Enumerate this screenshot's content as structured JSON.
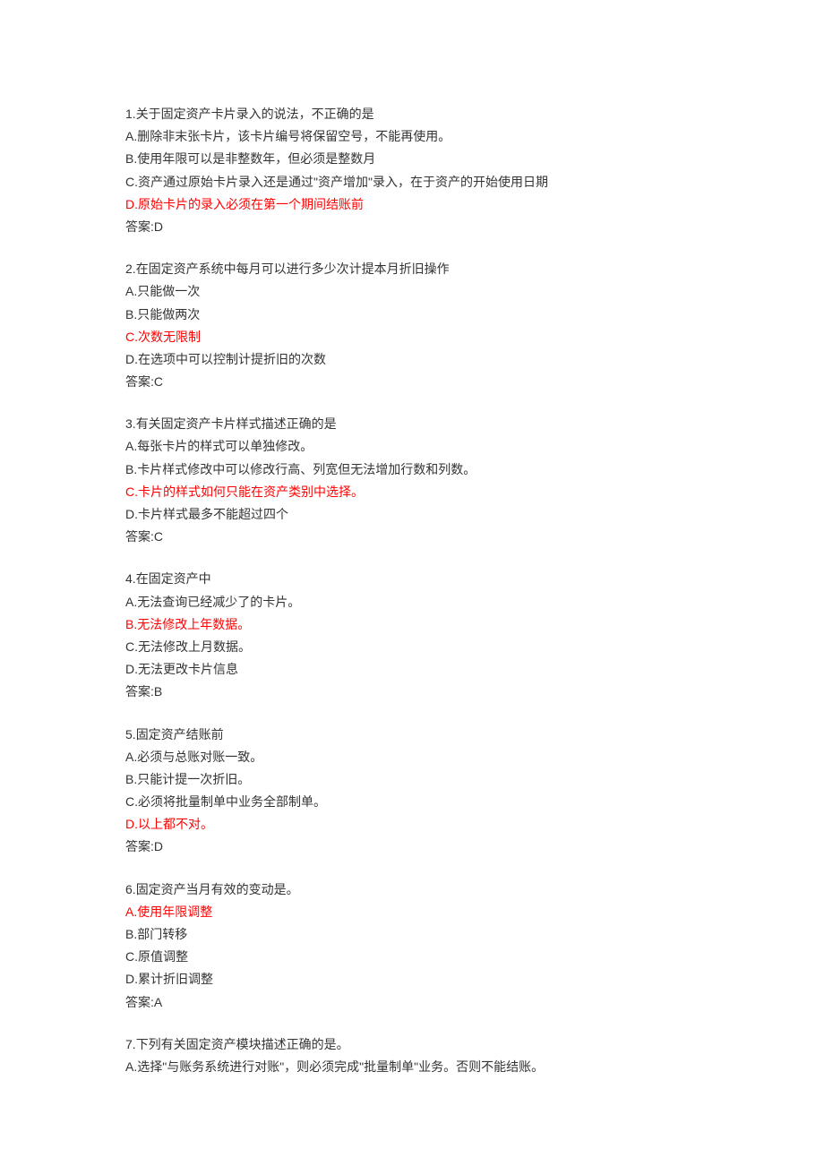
{
  "questions": [
    {
      "number": "1.",
      "text": "关于固定资产卡片录入的说法，不正确的是",
      "options": [
        {
          "label": "A.删除非末张卡片，该卡片编号将保留空号，不能再使用。",
          "correct": false
        },
        {
          "label": "B.使用年限可以是非整数年，但必须是整数月",
          "correct": false
        },
        {
          "label": "C.资产通过原始卡片录入还是通过\"资产增加\"录入，在于资产的开始使用日期",
          "correct": false
        },
        {
          "label": "D.原始卡片的录入必须在第一个期间结账前",
          "correct": true
        }
      ],
      "answer": "答案:D"
    },
    {
      "number": "2.",
      "text": "在固定资产系统中每月可以进行多少次计提本月折旧操作",
      "options": [
        {
          "label": "A.只能做一次",
          "correct": false
        },
        {
          "label": "B.只能做两次",
          "correct": false
        },
        {
          "label": "C.次数无限制",
          "correct": true
        },
        {
          "label": "D.在选项中可以控制计提折旧的次数",
          "correct": false
        }
      ],
      "answer": "答案:C"
    },
    {
      "number": "3.",
      "text": "有关固定资产卡片样式描述正确的是",
      "options": [
        {
          "label": "A.每张卡片的样式可以单独修改。",
          "correct": false
        },
        {
          "label": "B.卡片样式修改中可以修改行高、列宽但无法增加行数和列数。",
          "correct": false
        },
        {
          "label": "C.卡片的样式如何只能在资产类别中选择。",
          "correct": true
        },
        {
          "label": "D.卡片样式最多不能超过四个",
          "correct": false
        }
      ],
      "answer": "答案:C"
    },
    {
      "number": "4.",
      "text": "在固定资产中",
      "options": [
        {
          "label": "A.无法查询已经减少了的卡片。",
          "correct": false
        },
        {
          "label": "B.无法修改上年数据。",
          "correct": true
        },
        {
          "label": "C.无法修改上月数据。",
          "correct": false
        },
        {
          "label": "D.无法更改卡片信息",
          "correct": false
        }
      ],
      "answer": "答案:B"
    },
    {
      "number": "5.",
      "text": "固定资产结账前",
      "options": [
        {
          "label": "A.必须与总账对账一致。",
          "correct": false
        },
        {
          "label": "B.只能计提一次折旧。",
          "correct": false
        },
        {
          "label": "C.必须将批量制单中业务全部制单。",
          "correct": false
        },
        {
          "label": "D.以上都不对。",
          "correct": true
        }
      ],
      "answer": "答案:D"
    },
    {
      "number": "6.",
      "text": "固定资产当月有效的变动是。",
      "options": [
        {
          "label": "A.使用年限调整",
          "correct": true
        },
        {
          "label": "B.部门转移",
          "correct": false
        },
        {
          "label": "C.原值调整",
          "correct": false
        },
        {
          "label": "D.累计折旧调整",
          "correct": false
        }
      ],
      "answer": "答案:A"
    },
    {
      "number": "7.",
      "text": "下列有关固定资产模块描述正确的是。",
      "options": [
        {
          "label": "A.选择\"与账务系统进行对账\"，则必须完成\"批量制单\"业务。否则不能结账。",
          "correct": false
        }
      ],
      "answer": ""
    }
  ]
}
